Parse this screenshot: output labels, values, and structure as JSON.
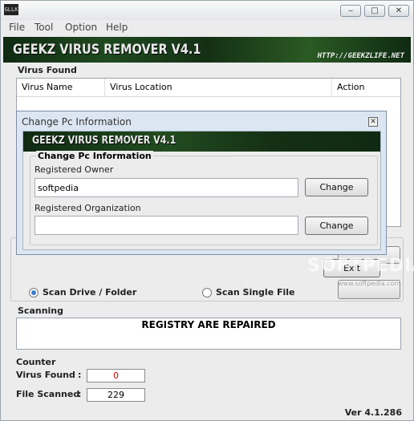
{
  "window": {
    "icon_text": "GLLK",
    "minimize_symbol": "‒",
    "maximize_symbol": "□",
    "close_symbol": "✕"
  },
  "menu": [
    "File",
    "Tool",
    "Option",
    "Help"
  ],
  "banner": {
    "title": "GEEKZ VIRUS REMOVER V4.1",
    "url": "HTTP://GEEKZLIFE.NET"
  },
  "virus_found": {
    "label": "Virus Found",
    "columns": [
      "Virus Name",
      "Virus Location",
      "Action"
    ]
  },
  "scan_options": {
    "drive_folder": "Scan Drive / Folder",
    "single_file": "Scan Single File",
    "selected": "drive_folder"
  },
  "scanning": {
    "label": "Scanning",
    "status": "REGISTRY ARE REPAIRED"
  },
  "counter": {
    "label": "Counter",
    "virus_found_label": "Virus Found",
    "virus_found_value": "0",
    "file_scanned_label": "File Scanned",
    "file_scanned_value": "229",
    "colon": ":"
  },
  "version": "Ver 4.1.286",
  "dialog": {
    "title": "Change Pc Information",
    "close_symbol": "✕",
    "banner_title": "GEEKZ VIRUS REMOVER V4.1",
    "group_label": "Change Pc Information",
    "owner_label": "Registered Owner",
    "owner_value": "softpedia",
    "org_label": "Registered Organization",
    "org_value": "",
    "change_label": "Change",
    "exit_label": "Exit"
  },
  "watermark": {
    "text": "SOFTPEDIA",
    "url": "www.softpedia.com"
  },
  "colors": {
    "virus_count": "#e00000",
    "banner_green": "#1f4a1f"
  }
}
